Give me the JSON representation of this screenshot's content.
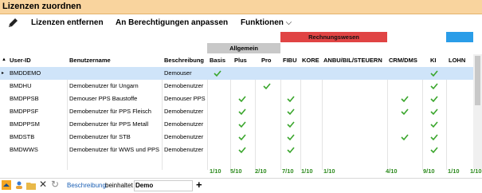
{
  "window": {
    "title": "Lizenzen zuordnen"
  },
  "toolbar": {
    "edit_icon": "pencil-icon",
    "remove": "Lizenzen entfernen",
    "adjust": "An Berechtigungen anpassen",
    "functions": "Funktionen"
  },
  "groups": {
    "allgemein": "Allgemein",
    "rechnungswesen": "Rechnungswesen"
  },
  "colors": {
    "title_bg": "#f9d49e",
    "group_red": "#e04444",
    "group_blue": "#2a9de8",
    "check": "#3aa62c",
    "selection": "#cfe4f9"
  },
  "columns": {
    "user_id": "User-ID",
    "name": "Benutzername",
    "desc": "Beschreibung",
    "basis": "Basis",
    "plus": "Plus",
    "pro": "Pro",
    "fibu": "FIBU",
    "kore": "KORE",
    "anbu": "ANBU/BIL/STEUERN",
    "crm": "CRM/DMS",
    "ki": "KI",
    "lohn": "LOHN"
  },
  "rows": [
    {
      "id": "BMDDEMO",
      "name": "",
      "desc": "Demouser",
      "checks": [
        "basis",
        "ki"
      ]
    },
    {
      "id": "BMDHU",
      "name": "Demobenutzer für Ungarn",
      "desc": "Demobenutzer",
      "checks": [
        "pro",
        "ki"
      ]
    },
    {
      "id": "BMDPPSB",
      "name": "Demouser PPS Baustoffe",
      "desc": "Demouser PPS",
      "checks": [
        "plus",
        "fibu",
        "crm",
        "ki"
      ]
    },
    {
      "id": "BMDPPSF",
      "name": "Demobenutzer für PPS Fleisch",
      "desc": "Demobenutzer",
      "checks": [
        "plus",
        "fibu",
        "crm",
        "ki"
      ]
    },
    {
      "id": "BMDPPSM",
      "name": "Demobenutzer für PPS Metall",
      "desc": "Demobenutzer",
      "checks": [
        "plus",
        "fibu",
        "ki"
      ]
    },
    {
      "id": "BMDSTB",
      "name": "Demobenutzer für STB",
      "desc": "Demobenutzer",
      "checks": [
        "plus",
        "fibu",
        "crm",
        "ki"
      ]
    },
    {
      "id": "BMDWWS",
      "name": "Demobenutzer für WWS und PPS",
      "desc": "Demobenutzer",
      "checks": [
        "plus",
        "fibu",
        "ki"
      ]
    }
  ],
  "summary": {
    "basis": "1/10",
    "plus": "5/10",
    "pro": "2/10",
    "fibu": "7/10",
    "kore": "1/10",
    "anbu": "1/10",
    "crm": "4/10",
    "ki": "9/10",
    "lohn1": "1/10",
    "lohn2": "1/10"
  },
  "filter": {
    "field": "Beschreibung",
    "op": "beinhaltet",
    "value": "Demo"
  }
}
